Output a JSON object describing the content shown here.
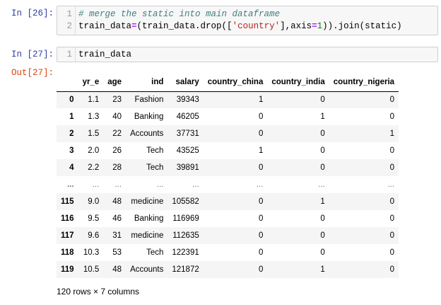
{
  "cells": [
    {
      "prompt": "In [26]:",
      "lines": [
        {
          "num": "1",
          "comment": "# merge the static into main dataframe"
        },
        {
          "num": "2",
          "tokens": [
            {
              "t": "train_data",
              "c": "plain"
            },
            {
              "t": "=",
              "c": "op"
            },
            {
              "t": "(train_data.drop([",
              "c": "plain"
            },
            {
              "t": "'country'",
              "c": "str"
            },
            {
              "t": "],axis",
              "c": "plain"
            },
            {
              "t": "=",
              "c": "op"
            },
            {
              "t": "1",
              "c": "num"
            },
            {
              "t": ")).join(static)",
              "c": "plain"
            }
          ]
        }
      ]
    },
    {
      "prompt": "In [27]:",
      "lines": [
        {
          "num": "1",
          "tokens": [
            {
              "t": "train_data",
              "c": "plain"
            }
          ]
        }
      ]
    }
  ],
  "output": {
    "prompt": "Out[27]:",
    "columns": [
      "",
      "yr_e",
      "age",
      "ind",
      "salary",
      "country_china",
      "country_india",
      "country_nigeria"
    ],
    "rows": [
      [
        "0",
        "1.1",
        "23",
        "Fashion",
        "39343",
        "1",
        "0",
        "0"
      ],
      [
        "1",
        "1.3",
        "40",
        "Banking",
        "46205",
        "0",
        "1",
        "0"
      ],
      [
        "2",
        "1.5",
        "22",
        "Accounts",
        "37731",
        "0",
        "0",
        "1"
      ],
      [
        "3",
        "2.0",
        "26",
        "Tech",
        "43525",
        "1",
        "0",
        "0"
      ],
      [
        "4",
        "2.2",
        "28",
        "Tech",
        "39891",
        "0",
        "0",
        "0"
      ],
      [
        "...",
        "...",
        "...",
        "...",
        "...",
        "...",
        "...",
        "..."
      ],
      [
        "115",
        "9.0",
        "48",
        "medicine",
        "105582",
        "0",
        "1",
        "0"
      ],
      [
        "116",
        "9.5",
        "46",
        "Banking",
        "116969",
        "0",
        "0",
        "0"
      ],
      [
        "117",
        "9.6",
        "31",
        "medicine",
        "112635",
        "0",
        "0",
        "0"
      ],
      [
        "118",
        "10.3",
        "53",
        "Tech",
        "122391",
        "0",
        "0",
        "0"
      ],
      [
        "119",
        "10.5",
        "48",
        "Accounts",
        "121872",
        "0",
        "1",
        "0"
      ]
    ],
    "shape": "120 rows × 7 columns"
  }
}
